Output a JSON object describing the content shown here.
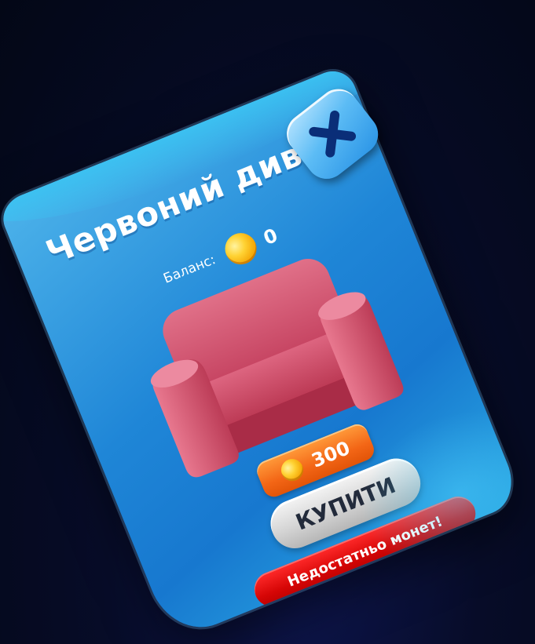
{
  "popup": {
    "title": "Червоний диван",
    "balance_label": "Баланс:",
    "balance_value": "0",
    "item_icon": "sofa-icon",
    "item_color": "#d8506a",
    "price_value": "300",
    "buy_label": "КУПИТИ",
    "error_text": "Недостатньо монет!",
    "close_icon": "close-icon"
  },
  "colors": {
    "panel": "#1f86d7",
    "price_badge": "#f36616",
    "buy_button": "#d4d4d4",
    "error_banner": "#d60606",
    "coin": "#ffd233"
  }
}
